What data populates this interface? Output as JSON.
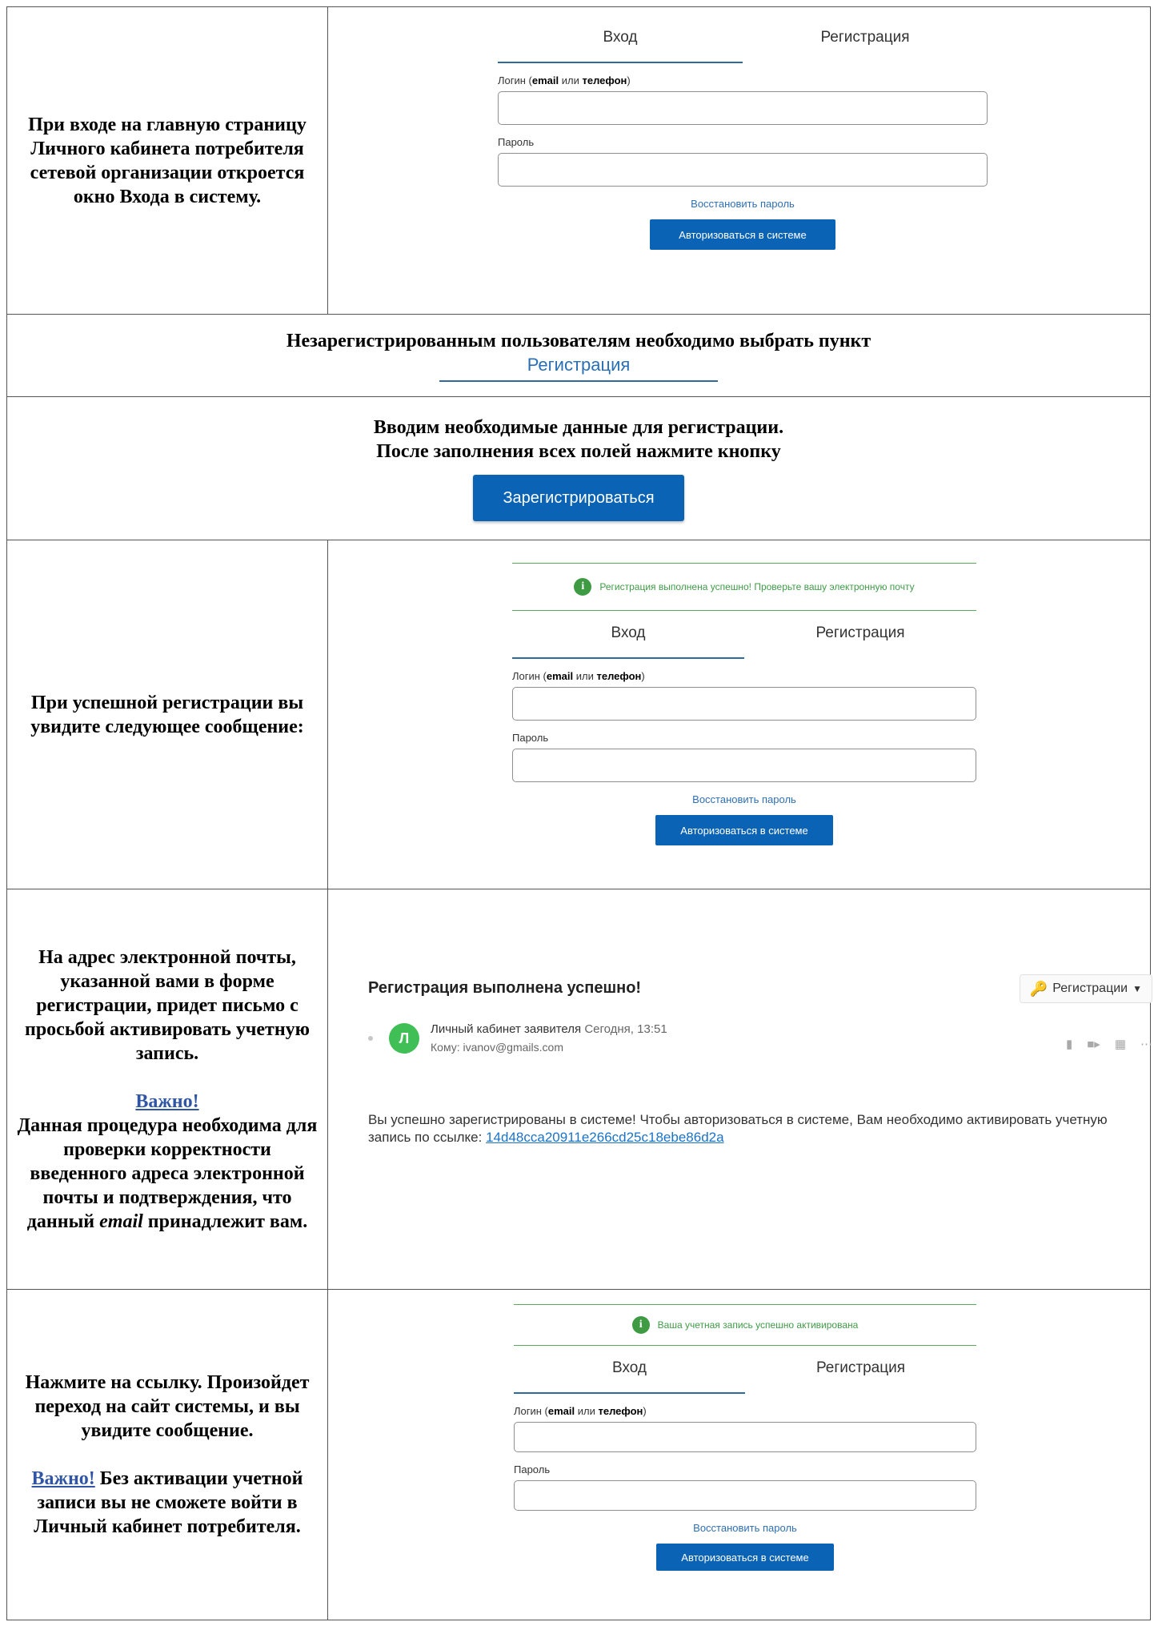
{
  "rows": {
    "r1": {
      "text": "При входе на главную страницу Личного кабинета потребителя сетевой организации откроется окно Входа в систему."
    },
    "r2": {
      "text": "Незарегистрированным пользователям необходимо выбрать пункт",
      "tab_label": "Регистрация"
    },
    "r3": {
      "line1": "Вводим необходимые данные для регистрации.",
      "line2": "После заполнения всех полей нажмите кнопку",
      "button_label": "Зарегистрироваться"
    },
    "r4": {
      "text": "При успешной регистрации вы увидите следующее сообщение:",
      "notice": "Регистрация выполнена успешно! Проверьте вашу электронную почту"
    },
    "r5": {
      "text": "На адрес электронной почты, указанной вами в форме регистрации, придет письмо с просьбой активировать учетную запись.",
      "important": "Важно!",
      "note_before": "Данная процедура необходима для проверки корректности введенного адреса электронной почты и подтверждения, что данный",
      "note_em": "email",
      "note_after": "принадлежит вам."
    },
    "r6": {
      "text": "Нажмите на ссылку. Произойдет переход на сайт системы, и вы увидите сообщение.",
      "important": "Важно!",
      "note": "Без активации учетной записи вы не сможете войти в Личный кабинет потребителя.",
      "notice": "Ваша учетная запись успешно активирована"
    }
  },
  "login_form": {
    "tab_login": "Вход",
    "tab_register": "Регистрация",
    "login_label_prefix": "Логин (",
    "login_label_email": "email",
    "login_label_or": " или ",
    "login_label_phone": "телефон",
    "login_label_suffix": ")",
    "password_label": "Пароль",
    "restore_link": "Восстановить пароль",
    "submit": "Авторизоваться в системе"
  },
  "email": {
    "subject": "Регистрация выполнена успешно!",
    "folder": "Регистрации",
    "avatar_letter": "Л",
    "sender": "Личный кабинет заявителя",
    "time": "Сегодня, 13:51",
    "to": "Кому: ivanov@gmails.com",
    "body": "Вы успешно зарегистрированы в системе! Чтобы авторизоваться в системе, Вам необходимо активировать учетную запись по ссылке:",
    "link": "14d48cca20911e266cd25c18ebe86d2a"
  },
  "icons": [
    "info-icon",
    "key-icon",
    "bookmark-icon",
    "video-icon",
    "calendar-icon",
    "more-icon"
  ],
  "colors": {
    "primary": "#0a63b4",
    "link": "#2f6fb3",
    "success": "#3e9b43",
    "important": "#2f55a4",
    "avatar": "#3fbf55"
  }
}
